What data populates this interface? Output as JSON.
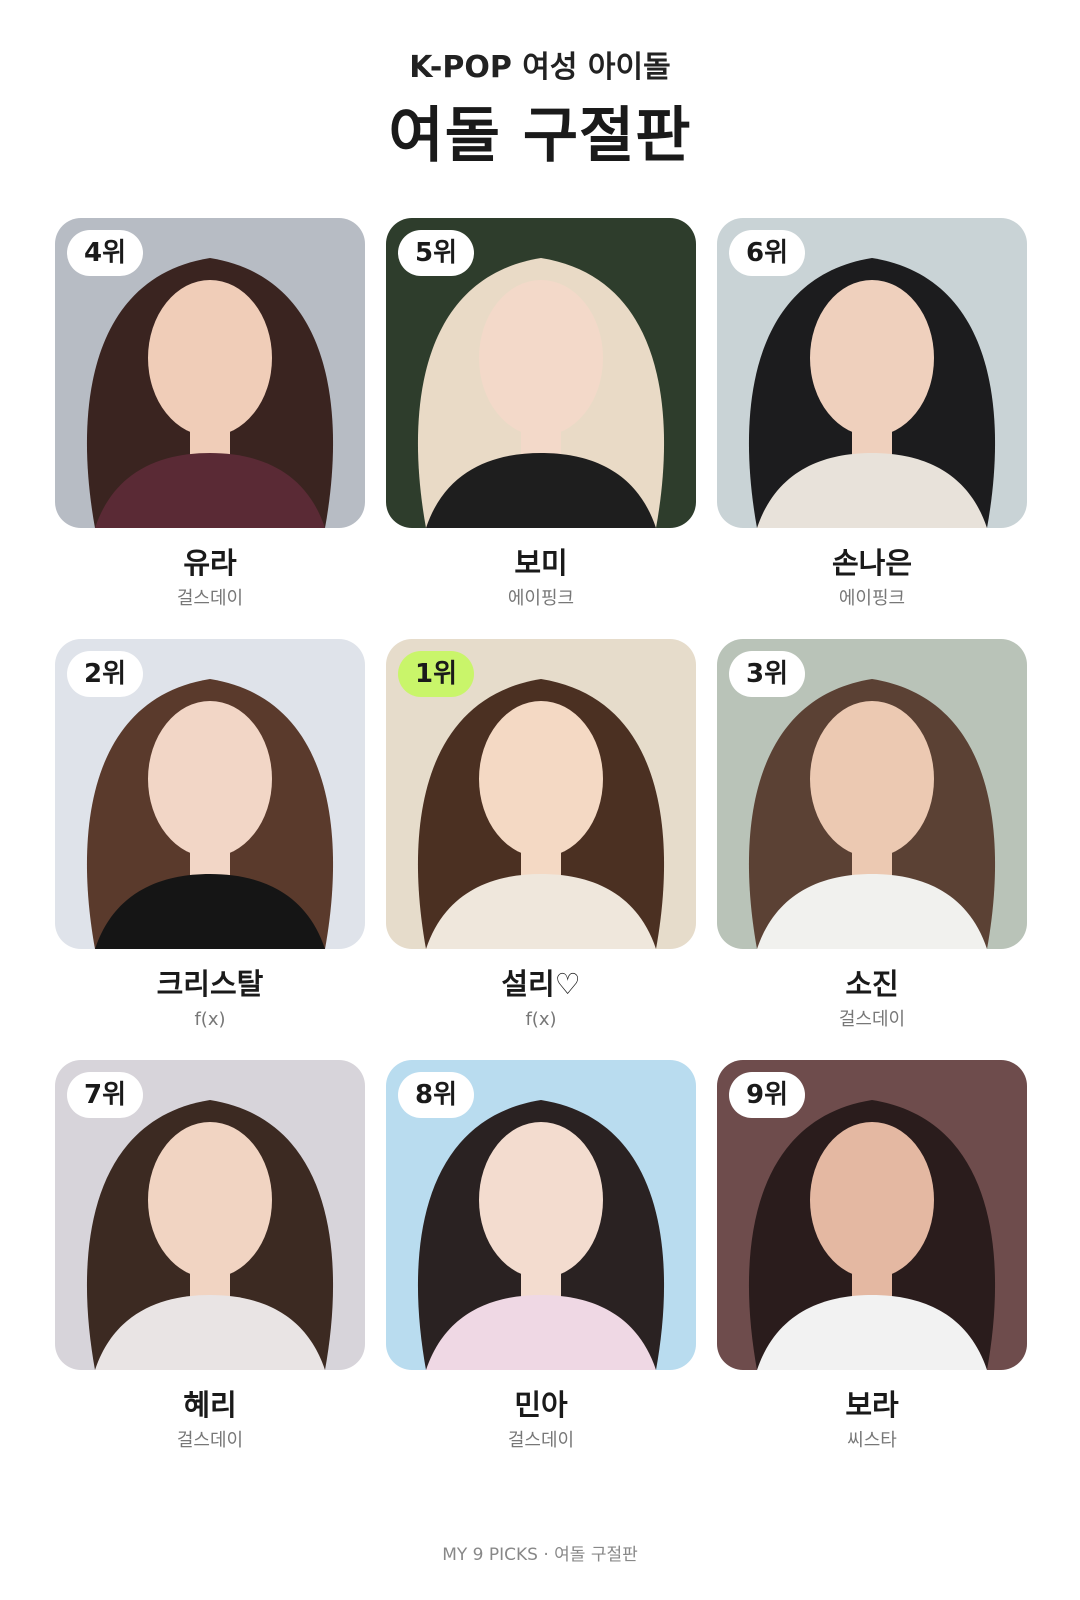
{
  "header": {
    "subtitle": "K-POP 여성 아이돌",
    "title": "여돌 구절판"
  },
  "cards": [
    {
      "rank": "4위",
      "name": "유라",
      "group": "걸스데이",
      "highlight": false,
      "colors": {
        "bg": "#b7bcc4",
        "hair": "#3a2420",
        "skin": "#f0cdb8",
        "cloth": "#5a2a35"
      }
    },
    {
      "rank": "5위",
      "name": "보미",
      "group": "에이핑크",
      "highlight": false,
      "colors": {
        "bg": "#2e3d2c",
        "hair": "#e9dac6",
        "skin": "#f3d9c9",
        "cloth": "#1e1e1e"
      }
    },
    {
      "rank": "6위",
      "name": "손나은",
      "group": "에이핑크",
      "highlight": false,
      "colors": {
        "bg": "#c9d3d6",
        "hair": "#1c1c1e",
        "skin": "#efd0bd",
        "cloth": "#e8e2da"
      }
    },
    {
      "rank": "2위",
      "name": "크리스탈",
      "group": "f(x)",
      "highlight": false,
      "colors": {
        "bg": "#dfe3ea",
        "hair": "#5a3a2c",
        "skin": "#f2d6c6",
        "cloth": "#151515"
      }
    },
    {
      "rank": "1위",
      "name": "설리♡",
      "group": "f(x)",
      "highlight": true,
      "colors": {
        "bg": "#e6dccb",
        "hair": "#4b3022",
        "skin": "#f4d9c4",
        "cloth": "#efe7dc"
      }
    },
    {
      "rank": "3위",
      "name": "소진",
      "group": "걸스데이",
      "highlight": false,
      "colors": {
        "bg": "#b9c3b8",
        "hair": "#5b4134",
        "skin": "#ecc9b2",
        "cloth": "#f1f1ee"
      }
    },
    {
      "rank": "7위",
      "name": "혜리",
      "group": "걸스데이",
      "highlight": false,
      "colors": {
        "bg": "#d7d4da",
        "hair": "#3c2a22",
        "skin": "#f1d4c2",
        "cloth": "#e9e4e4"
      }
    },
    {
      "rank": "8위",
      "name": "민아",
      "group": "걸스데이",
      "highlight": false,
      "colors": {
        "bg": "#b9dcef",
        "hair": "#2a2222",
        "skin": "#f3dccf",
        "cloth": "#efd8e4"
      }
    },
    {
      "rank": "9위",
      "name": "보라",
      "group": "씨스타",
      "highlight": false,
      "colors": {
        "bg": "#6e4c4c",
        "hair": "#2a1c1c",
        "skin": "#e4b8a2",
        "cloth": "#f2f2f2"
      }
    }
  ],
  "footer": {
    "text": "MY 9 PICKS · 여돌 구절판"
  }
}
